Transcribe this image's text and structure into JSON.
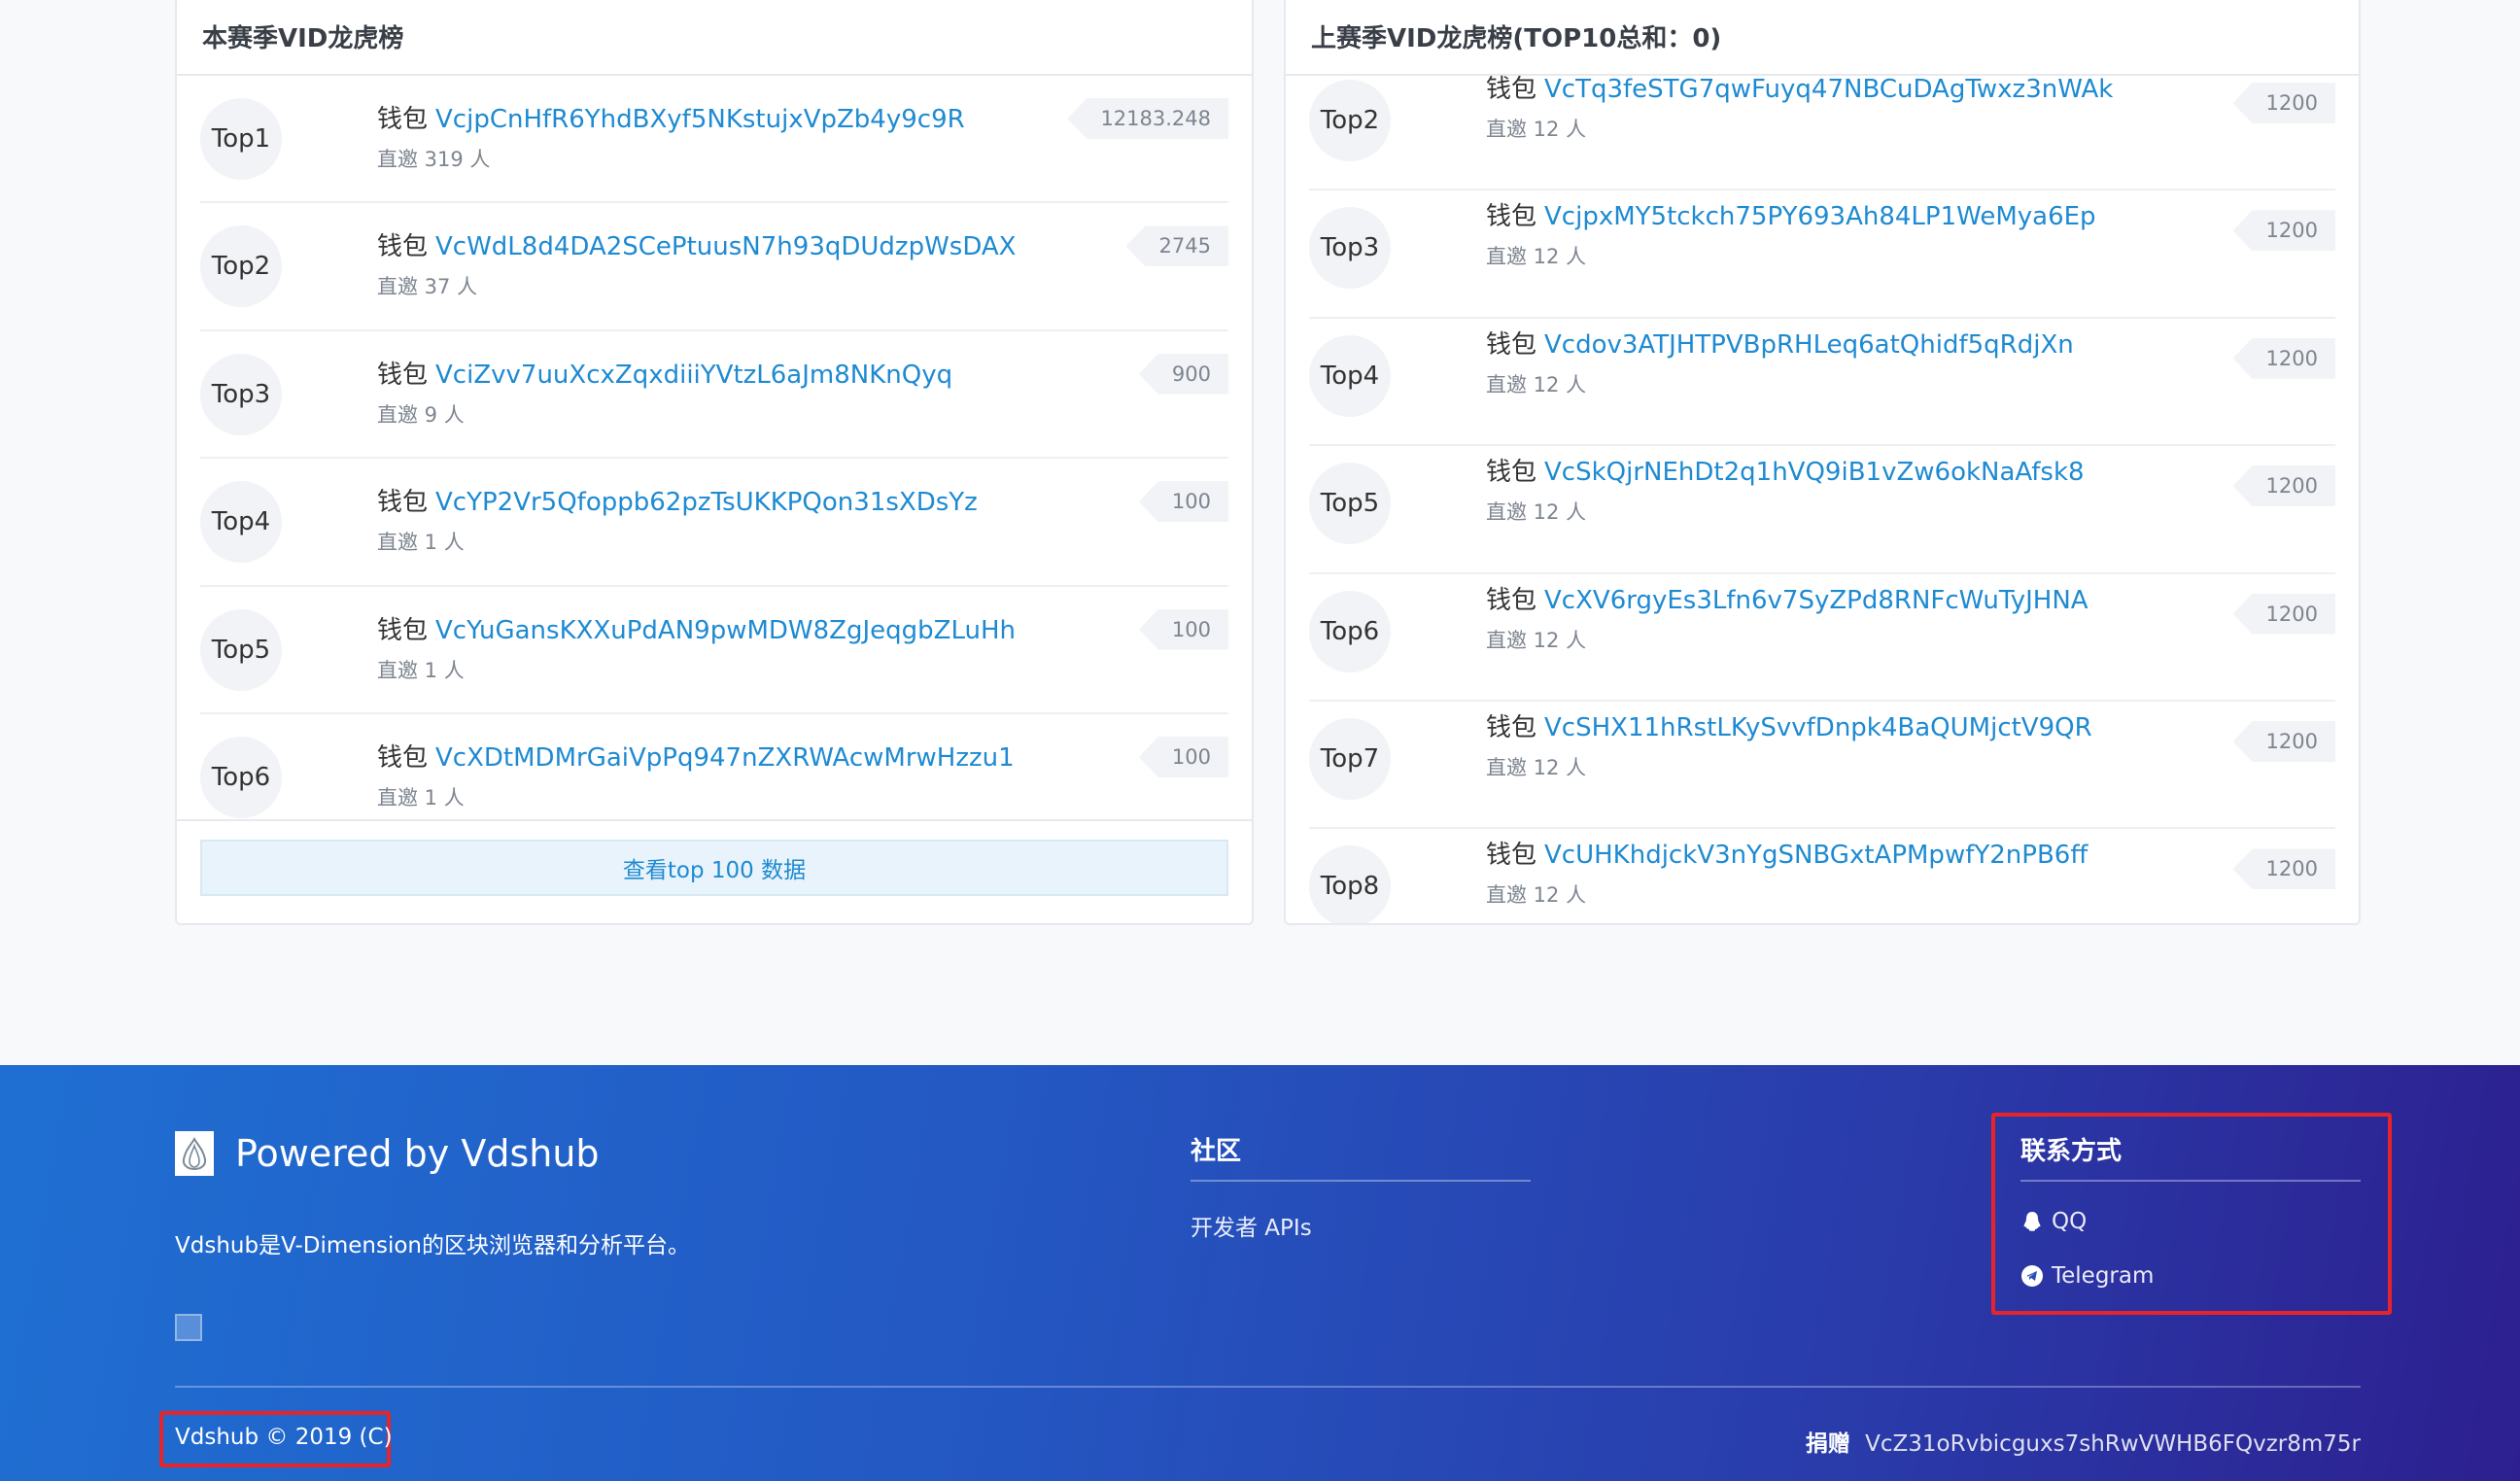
{
  "left_panel": {
    "title": "本赛季VID龙虎榜",
    "wallet_prefix": "钱包",
    "rows": [
      {
        "rank": "Top1",
        "address": "VcjpCnHfR6YhdBXyf5NKstujxVpZb4y9c9R",
        "invite": "直邀 319 人",
        "score": "12183.248"
      },
      {
        "rank": "Top2",
        "address": "VcWdL8d4DA2SCePtuusN7h93qDUdzpWsDAX",
        "invite": "直邀 37 人",
        "score": "2745"
      },
      {
        "rank": "Top3",
        "address": "VciZvv7uuXcxZqxdiiiYVtzL6aJm8NKnQyq",
        "invite": "直邀 9 人",
        "score": "900"
      },
      {
        "rank": "Top4",
        "address": "VcYP2Vr5Qfoppb62pzTsUKKPQon31sXDsYz",
        "invite": "直邀 1 人",
        "score": "100"
      },
      {
        "rank": "Top5",
        "address": "VcYuGansKXXuPdAN9pwMDW8ZgJeqgbZLuHh",
        "invite": "直邀 1 人",
        "score": "100"
      },
      {
        "rank": "Top6",
        "address": "VcXDtMDMrGaiVpPq947nZXRWAcwMrwHzzu1",
        "invite": "直邀 1 人",
        "score": "100"
      }
    ],
    "more_label": "查看top 100 数据"
  },
  "right_panel": {
    "title": "上赛季VID龙虎榜(TOP10总和：0)",
    "wallet_prefix": "钱包",
    "rows": [
      {
        "rank": "Top2",
        "address": "VcTq3feSTG7qwFuyq47NBCuDAgTwxz3nWAk",
        "invite": "直邀 12 人",
        "score": "1200"
      },
      {
        "rank": "Top3",
        "address": "VcjpxMY5tckch75PY693Ah84LP1WeMya6Ep",
        "invite": "直邀 12 人",
        "score": "1200"
      },
      {
        "rank": "Top4",
        "address": "Vcdov3ATJHTPVBpRHLeq6atQhidf5qRdjXn",
        "invite": "直邀 12 人",
        "score": "1200"
      },
      {
        "rank": "Top5",
        "address": "VcSkQjrNEhDt2q1hVQ9iB1vZw6okNaAfsk8",
        "invite": "直邀 12 人",
        "score": "1200"
      },
      {
        "rank": "Top6",
        "address": "VcXV6rgyEs3Lfn6v7SyZPd8RNFcWuTyJHNA",
        "invite": "直邀 12 人",
        "score": "1200"
      },
      {
        "rank": "Top7",
        "address": "VcSHX11hRstLKySvvfDnpk4BaQUMjctV9QR",
        "invite": "直邀 12 人",
        "score": "1200"
      },
      {
        "rank": "Top8",
        "address": "VcUHKhdjckV3nYgSNBGxtAPMpwfY2nPB6ff",
        "invite": "直邀 12 人",
        "score": "1200"
      }
    ]
  },
  "footer": {
    "brand_title": "Powered by Vdshub",
    "brand_desc": "Vdshub是V-Dimension的区块浏览器和分析平台。",
    "community": {
      "title": "社区",
      "links": [
        "开发者 APIs"
      ]
    },
    "contact": {
      "title": "联系方式",
      "qq": "QQ",
      "telegram": "Telegram"
    },
    "copyright": "Vdshub © 2019 (C)",
    "donate_label": "捐赠",
    "donate_address": "VcZ31oRvbicguxs7shRwVWHB6FQvzr8m75r"
  },
  "colors": {
    "link": "#1e8ad2",
    "highlight": "#e8242b",
    "footer_start": "#1f6fd2",
    "footer_end": "#2d1f8f"
  }
}
